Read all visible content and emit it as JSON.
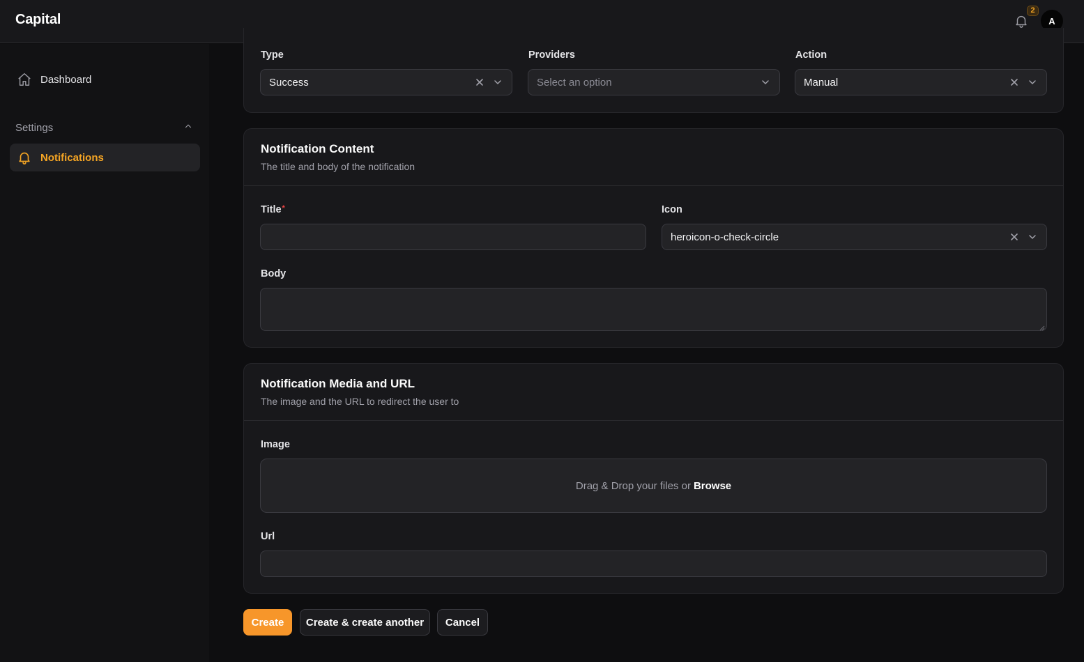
{
  "app": {
    "title": "Capital"
  },
  "header": {
    "notification_count": "2",
    "avatar_initial": "A"
  },
  "sidebar": {
    "dashboard_label": "Dashboard",
    "settings_group_label": "Settings",
    "notifications_label": "Notifications"
  },
  "top_fields": {
    "type": {
      "label": "Type",
      "value": "Success"
    },
    "providers": {
      "label": "Providers",
      "placeholder": "Select an option"
    },
    "action": {
      "label": "Action",
      "value": "Manual"
    }
  },
  "content_section": {
    "title": "Notification Content",
    "subtitle": "The title and body of the notification",
    "title_field": {
      "label": "Title",
      "required_mark": "*",
      "value": ""
    },
    "icon_field": {
      "label": "Icon",
      "value": "heroicon-o-check-circle"
    },
    "body_field": {
      "label": "Body",
      "value": ""
    }
  },
  "media_section": {
    "title": "Notification Media and URL",
    "subtitle": "The image and the URL to redirect the user to",
    "image_field": {
      "label": "Image",
      "drop_text": "Drag & Drop your files or",
      "browse_text": "Browse"
    },
    "url_field": {
      "label": "Url",
      "value": ""
    }
  },
  "actions": {
    "create": "Create",
    "create_another": "Create & create another",
    "cancel": "Cancel"
  },
  "colors": {
    "accent": "#f5a524",
    "primary_button": "#f7962a",
    "required": "#ef4444"
  }
}
